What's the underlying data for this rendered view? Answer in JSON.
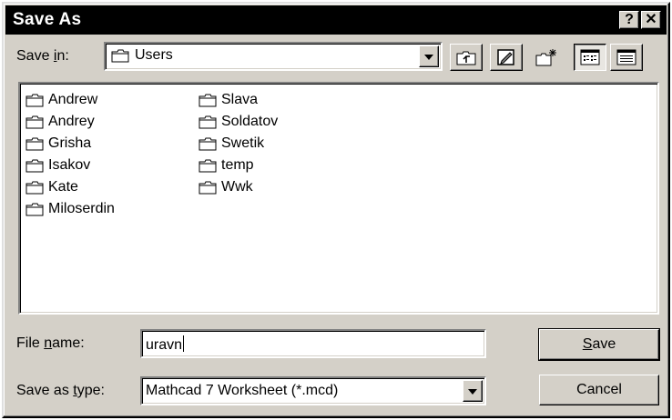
{
  "window": {
    "title": "Save As",
    "help_glyph": "?",
    "close_glyph": "✕"
  },
  "toolbar": {
    "save_in_label_pre": "Save ",
    "save_in_label_key": "i",
    "save_in_label_post": "n:",
    "save_in_value": "Users",
    "buttons": [
      "up-one-level-icon",
      "desktop-icon",
      "new-folder-icon",
      "list-view-icon",
      "details-view-icon"
    ]
  },
  "files": {
    "column1": [
      "Andrew",
      "Andrey",
      "Grisha",
      "Isakov",
      "Kate",
      "Miloserdin"
    ],
    "column2": [
      "Slava",
      "Soldatov",
      "Swetik",
      "temp",
      "Wwk"
    ]
  },
  "form": {
    "file_name_label_pre": "File ",
    "file_name_label_key": "n",
    "file_name_label_post": "ame:",
    "file_name_value": "uravn",
    "save_as_type_label_pre": "Save as ",
    "save_as_type_label_key": "t",
    "save_as_type_label_post": "ype:",
    "save_as_type_value": "Mathcad 7 Worksheet (*.mcd)"
  },
  "actions": {
    "save_key": "S",
    "save_rest": "ave",
    "cancel_label": "Cancel"
  }
}
